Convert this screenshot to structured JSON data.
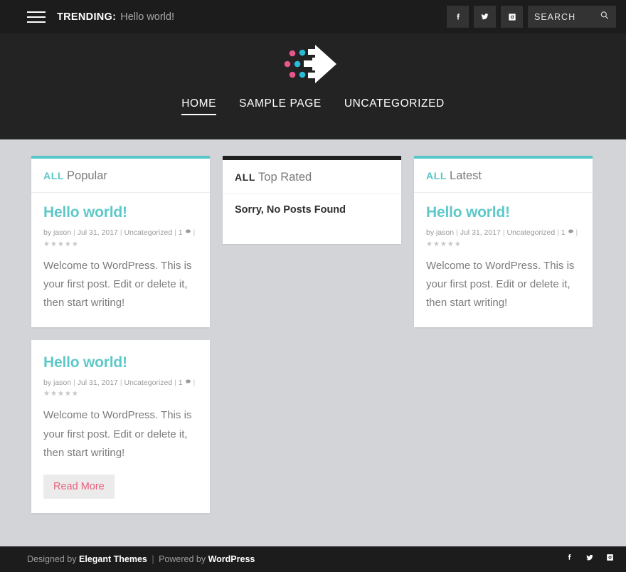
{
  "topbar": {
    "menu_icon": "hamburger-icon",
    "trending_label": "TRENDING:",
    "trending_text": "Hello world!",
    "social": [
      {
        "name": "facebook-icon",
        "label": "Facebook"
      },
      {
        "name": "twitter-icon",
        "label": "Twitter"
      },
      {
        "name": "instagram-icon",
        "label": "Instagram"
      }
    ],
    "search": {
      "placeholder": "SEARCH",
      "value": "",
      "icon": "search-icon"
    }
  },
  "header": {
    "logo_name": "site-logo-arrow",
    "logo_colors": {
      "pink": "#e8558d",
      "cyan": "#29bcd8",
      "arrow": "#ffffff"
    },
    "nav": [
      {
        "label": "HOME",
        "active": true
      },
      {
        "label": "SAMPLE PAGE",
        "active": false
      },
      {
        "label": "UNCATEGORIZED",
        "active": false
      }
    ]
  },
  "colors": {
    "accent_teal": "#57c8c8",
    "accent_pink": "#e8617d",
    "page_bg": "#d2d4d7",
    "dark": "#1c1c1c"
  },
  "cards": [
    {
      "id": "popular",
      "accent": "teal",
      "tag": "ALL",
      "title": "Popular",
      "empty": null,
      "post": {
        "title": "Hello world!",
        "author": "by jason",
        "date": "Jul 31, 2017",
        "category": "Uncategorized",
        "comments": "1",
        "comment_icon": "comment-bubble-icon",
        "stars": "★★★★★",
        "rating": 0,
        "excerpt": "Welcome to WordPress. This is your first post. Edit or delete it, then start writing!",
        "read_more": null
      }
    },
    {
      "id": "top-rated",
      "accent": "dark",
      "tag": "ALL",
      "title": "Top Rated",
      "empty": "Sorry, No Posts Found",
      "post": null
    },
    {
      "id": "latest",
      "accent": "teal",
      "tag": "ALL",
      "title": "Latest",
      "empty": null,
      "post": {
        "title": "Hello world!",
        "author": "by jason",
        "date": "Jul 31, 2017",
        "category": "Uncategorized",
        "comments": "1",
        "comment_icon": "comment-bubble-icon",
        "stars": "★★★★★",
        "rating": 0,
        "excerpt": "Welcome to WordPress. This is your first post. Edit or delete it, then start writing!",
        "read_more": null
      }
    },
    {
      "id": "featured-post",
      "accent": "none",
      "tag": null,
      "title": null,
      "empty": null,
      "post": {
        "title": "Hello world!",
        "author": "by jason",
        "date": "Jul 31, 2017",
        "category": "Uncategorized",
        "comments": "1",
        "comment_icon": "comment-bubble-icon",
        "stars": "★★★★★",
        "rating": 0,
        "excerpt": "Welcome to WordPress. This is your first post. Edit or delete it, then start writing!",
        "read_more": "Read More"
      }
    }
  ],
  "footer": {
    "designed_by": "Designed by",
    "designer": "Elegant Themes",
    "separator": "|",
    "powered_by": "Powered by",
    "platform": "WordPress",
    "social": [
      {
        "name": "facebook-icon",
        "label": "Facebook"
      },
      {
        "name": "twitter-icon",
        "label": "Twitter"
      },
      {
        "name": "instagram-icon",
        "label": "Instagram"
      }
    ]
  }
}
